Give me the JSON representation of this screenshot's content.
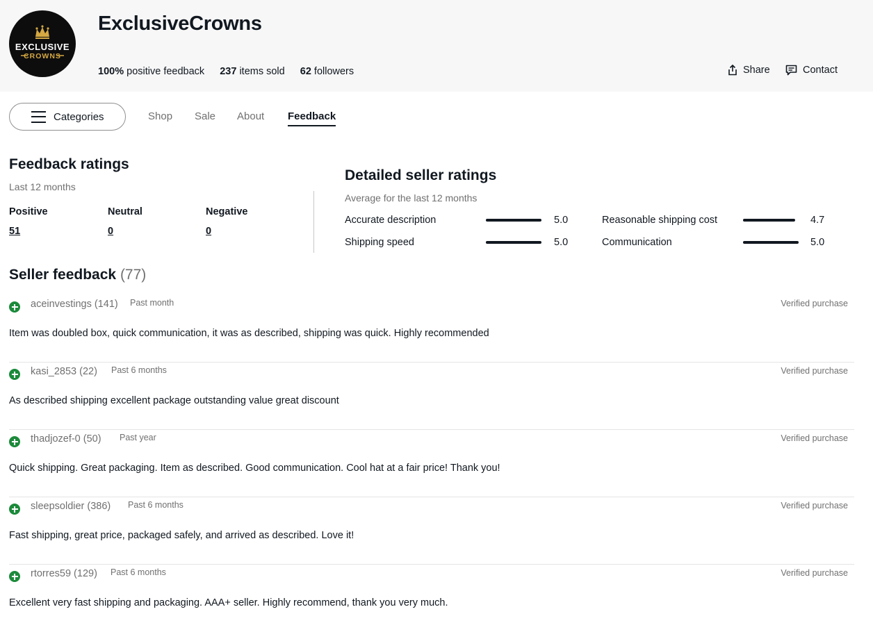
{
  "store": {
    "logo_line1": "EXCLUSIVE",
    "logo_line2": "CROWNS",
    "name": "ExclusiveCrowns",
    "positive_pct": "100%",
    "positive_label": "positive feedback",
    "items_sold": "237",
    "items_sold_label": "items sold",
    "followers": "62",
    "followers_label": "followers",
    "share_label": "Share",
    "contact_label": "Contact"
  },
  "nav": {
    "categories_label": "Categories",
    "tabs": [
      {
        "label": "Shop"
      },
      {
        "label": "Sale"
      },
      {
        "label": "About"
      },
      {
        "label": "Feedback",
        "active": true
      }
    ]
  },
  "feedback_ratings": {
    "title": "Feedback ratings",
    "period": "Last 12 months",
    "positive_label": "Positive",
    "positive_value": "51",
    "neutral_label": "Neutral",
    "neutral_value": "0",
    "negative_label": "Negative",
    "negative_value": "0"
  },
  "detailed_ratings": {
    "title": "Detailed seller ratings",
    "subtitle": "Average for the last 12 months",
    "items": [
      {
        "label": "Accurate description",
        "value": "5.0",
        "fraction": 1.0
      },
      {
        "label": "Shipping speed",
        "value": "5.0",
        "fraction": 1.0
      },
      {
        "label": "Reasonable shipping cost",
        "value": "4.7",
        "fraction": 0.94
      },
      {
        "label": "Communication",
        "value": "5.0",
        "fraction": 1.0
      }
    ]
  },
  "seller_feedback": {
    "title": "Seller feedback",
    "count": "(77)",
    "entries": [
      {
        "user": "aceinvestings (141)",
        "time": "Past month",
        "verified": "Verified purchase",
        "comment": "Item was doubled box, quick communication, it was as described, shipping was quick. Highly recommended"
      },
      {
        "user": "kasi_2853 (22)",
        "time": "Past 6 months",
        "verified": "Verified purchase",
        "comment": "As described shipping excellent package outstanding value great discount"
      },
      {
        "user": "thadjozef-0 (50)",
        "time": "Past year",
        "verified": "Verified purchase",
        "comment": "Quick shipping. Great packaging. Item as described. Good communication. Cool hat at a fair price! Thank you!"
      },
      {
        "user": "sleepsoldier (386)",
        "time": "Past 6 months",
        "verified": "Verified purchase",
        "comment": "Fast shipping, great price, packaged safely, and arrived as described. Love it!"
      },
      {
        "user": "rtorres59 (129)",
        "time": "Past 6 months",
        "verified": "Verified purchase",
        "comment": "Excellent very fast shipping and packaging. AAA+ seller. Highly recommend, thank you very much."
      }
    ]
  },
  "colors": {
    "header_bg": "#f7f7f7",
    "positive_icon": "#1b8a3a",
    "logo_gold": "#d4a843",
    "text_primary": "#111820",
    "text_secondary": "#707070"
  }
}
